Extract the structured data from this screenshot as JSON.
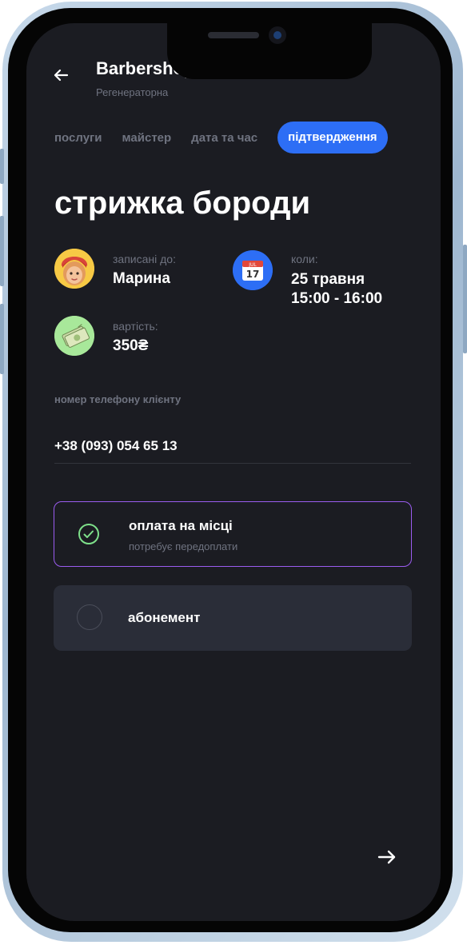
{
  "header": {
    "title": "Barbershop",
    "subtitle": "Регенераторна"
  },
  "tabs": [
    {
      "label": "послуги",
      "active": false
    },
    {
      "label": "майстер",
      "active": false
    },
    {
      "label": "дата та час",
      "active": false
    },
    {
      "label": "підтвердження",
      "active": true
    }
  ],
  "service": {
    "title": "стрижка бороди"
  },
  "booking": {
    "master_label": "записані до:",
    "master_name": "Марина",
    "when_label": "коли:",
    "date": "25 травня",
    "time": "15:00 - 16:00",
    "calendar_month": "JUL",
    "calendar_day": "17",
    "price_label": "вартість:",
    "price": "350₴"
  },
  "phone": {
    "label": "номер телефону клієнту",
    "value": "+38 (093) 054 65 13"
  },
  "payment": {
    "options": [
      {
        "title": "оплата на місці",
        "subtitle": "потребує передоплати",
        "selected": true
      },
      {
        "title": "абонемент",
        "subtitle": "",
        "selected": false
      }
    ]
  },
  "colors": {
    "background": "#1b1c22",
    "accent": "#2d6ef5",
    "selected_border": "#9b5cf0",
    "check": "#7ee08a",
    "muted_text": "#6f7380",
    "card": "#2a2d38"
  },
  "icons": {
    "back": "arrow-left-icon",
    "next": "arrow-right-icon",
    "check": "check-circle-icon",
    "calendar": "calendar-icon",
    "money": "money-icon"
  }
}
